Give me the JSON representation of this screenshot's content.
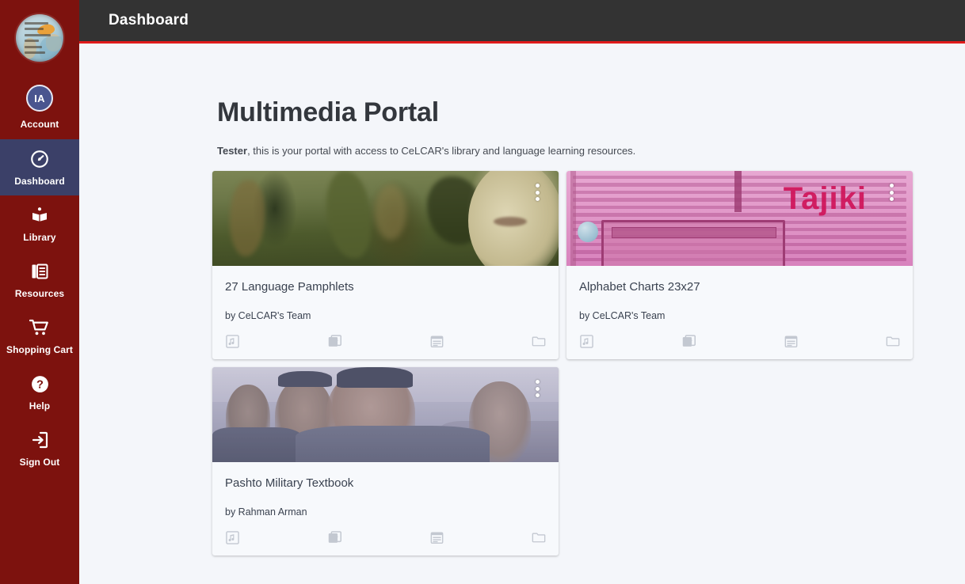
{
  "app": {
    "header_title": "Dashboard",
    "accent_color": "#e01b1b",
    "header_bg": "#333333",
    "sidebar_bg": "#7d120e",
    "sidebar_active_bg": "#3b4068",
    "page_bg": "#f4f6fa"
  },
  "sidebar": {
    "logo": {
      "name": "celcar-globe-logo",
      "alt": "Center for Languages of the Central Asian Region"
    },
    "items": [
      {
        "id": "account",
        "label": "Account",
        "icon": "avatar-initials-icon",
        "initials": "IA",
        "active": false
      },
      {
        "id": "dashboard",
        "label": "Dashboard",
        "icon": "speedometer-icon",
        "active": true
      },
      {
        "id": "library",
        "label": "Library",
        "icon": "open-book-icon",
        "active": false
      },
      {
        "id": "resources",
        "label": "Resources",
        "icon": "document-stack-icon",
        "active": false
      },
      {
        "id": "shopping-cart",
        "label": "Shopping Cart",
        "icon": "shopping-cart-icon",
        "active": false
      },
      {
        "id": "help",
        "label": "Help",
        "icon": "question-circle-icon",
        "active": false
      },
      {
        "id": "sign-out",
        "label": "Sign Out",
        "icon": "sign-out-icon",
        "active": false
      }
    ]
  },
  "main": {
    "title": "Multimedia Portal",
    "greeting_user": "Tester",
    "greeting_rest": ", this is your portal with access to CeLCAR's library and language learning resources.",
    "cards": [
      {
        "id": "language-pamphlets",
        "title": "27 Language Pamphlets",
        "author": "by CeLCAR's Team",
        "thumbnail": "photo-crowd-with-horse",
        "menu_icon": "kebab-menu-icon",
        "actions": [
          {
            "id": "audio",
            "icon": "music-note-icon",
            "label": "Audio"
          },
          {
            "id": "video",
            "icon": "video-library-icon",
            "label": "Video"
          },
          {
            "id": "text",
            "icon": "text-snippet-icon",
            "label": "Text"
          },
          {
            "id": "documents",
            "icon": "folder-icon",
            "label": "Documents"
          }
        ]
      },
      {
        "id": "alphabet-charts",
        "title": "Alphabet Charts 23x27",
        "author": "by CeLCAR's Team",
        "thumbnail": "tajiki-alphabet-chart",
        "thumbnail_text": "Tajiki",
        "menu_icon": "kebab-menu-icon",
        "actions": [
          {
            "id": "audio",
            "icon": "music-note-icon",
            "label": "Audio"
          },
          {
            "id": "video",
            "icon": "video-library-icon",
            "label": "Video"
          },
          {
            "id": "text",
            "icon": "text-snippet-icon",
            "label": "Text"
          },
          {
            "id": "documents",
            "icon": "folder-icon",
            "label": "Documents"
          }
        ]
      },
      {
        "id": "pashto-military-textbook",
        "title": "Pashto Military Textbook",
        "author": "by Rahman Arman",
        "thumbnail": "photo-police-officers",
        "menu_icon": "kebab-menu-icon",
        "actions": [
          {
            "id": "audio",
            "icon": "music-note-icon",
            "label": "Audio"
          },
          {
            "id": "video",
            "icon": "video-library-icon",
            "label": "Video"
          },
          {
            "id": "text",
            "icon": "text-snippet-icon",
            "label": "Text"
          },
          {
            "id": "documents",
            "icon": "folder-icon",
            "label": "Documents"
          }
        ]
      }
    ]
  }
}
